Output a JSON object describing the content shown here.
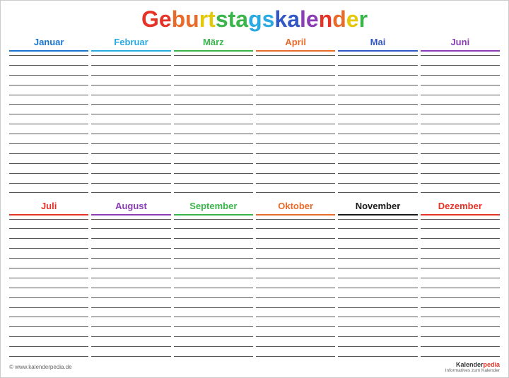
{
  "title": {
    "full": "Geburtstagskalender",
    "letters": [
      {
        "char": "G",
        "class": "title-g"
      },
      {
        "char": "e",
        "class": "title-e"
      },
      {
        "char": "b",
        "class": "title-b"
      },
      {
        "char": "u",
        "class": "title-u"
      },
      {
        "char": "r",
        "class": "title-r"
      },
      {
        "char": "t",
        "class": "title-t"
      },
      {
        "char": "s",
        "class": "title-s"
      },
      {
        "char": "t",
        "class": "title-t2"
      },
      {
        "char": "a",
        "class": "title-a"
      },
      {
        "char": "g",
        "class": "title-g2"
      },
      {
        "char": "s",
        "class": "title-s2"
      },
      {
        "char": "k",
        "class": "title-k"
      },
      {
        "char": "a",
        "class": "title-a2"
      },
      {
        "char": "l",
        "class": "title-l"
      },
      {
        "char": "e",
        "class": "title-e2"
      },
      {
        "char": "n",
        "class": "title-n"
      },
      {
        "char": "d",
        "class": "title-d"
      },
      {
        "char": "e",
        "class": "title-e3"
      },
      {
        "char": "r",
        "class": "title-r2"
      }
    ]
  },
  "months_top": [
    {
      "label": "Januar",
      "class": "januar"
    },
    {
      "label": "Februar",
      "class": "februar"
    },
    {
      "label": "März",
      "class": "maerz"
    },
    {
      "label": "April",
      "class": "april"
    },
    {
      "label": "Mai",
      "class": "mai"
    },
    {
      "label": "Juni",
      "class": "juni"
    }
  ],
  "months_bottom": [
    {
      "label": "Juli",
      "class": "juli"
    },
    {
      "label": "August",
      "class": "august"
    },
    {
      "label": "September",
      "class": "september"
    },
    {
      "label": "Oktober",
      "class": "oktober"
    },
    {
      "label": "November",
      "class": "november"
    },
    {
      "label": "Dezember",
      "class": "dezember"
    }
  ],
  "lines_count": 15,
  "footer": {
    "copyright": "© www.kalenderpedia.de",
    "logo_text": "Kalender",
    "logo_highlight": "pedia",
    "logo_sub": "Informatives zum Kalender"
  }
}
